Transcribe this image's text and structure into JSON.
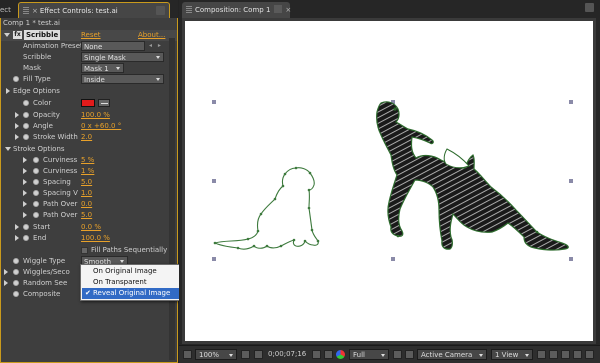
{
  "left_panel": {
    "cut_tab_label": "ect",
    "active_tab_label": "Effect Controls: test.ai",
    "comp_line": "Comp 1 * test.ai"
  },
  "effect": {
    "badge": "fx",
    "name": "Scribble",
    "reset_label": "Reset",
    "about_label": "About..."
  },
  "props": {
    "animation_preset": {
      "label": "Animation Preset",
      "value": "None"
    },
    "scribble": {
      "label": "Scribble",
      "value": "Single Mask"
    },
    "mask": {
      "label": "Mask",
      "value": "Mask 1"
    },
    "fill_type": {
      "label": "Fill Type",
      "value": "Inside"
    },
    "edge_options": {
      "label": "Edge Options"
    },
    "color": {
      "label": "Color",
      "value_color": "#e11b1b"
    },
    "opacity": {
      "label": "Opacity",
      "value": "100.0 %"
    },
    "angle": {
      "label": "Angle",
      "value": "0 x +60.0 °"
    },
    "stroke_width": {
      "label": "Stroke Width",
      "value": "2.0"
    },
    "stroke_options": {
      "label": "Stroke Options"
    },
    "curviness": {
      "label": "Curviness",
      "value": "5 %"
    },
    "curviness_var": {
      "label": "Curviness",
      "value": "1 %"
    },
    "spacing": {
      "label": "Spacing",
      "value": "5.0"
    },
    "spacing_var": {
      "label": "Spacing V",
      "value": "1.0"
    },
    "path_over1": {
      "label": "Path Over",
      "value": "0.0"
    },
    "path_over2": {
      "label": "Path Over",
      "value": "5.0"
    },
    "start": {
      "label": "Start",
      "value": "0.0 %"
    },
    "end": {
      "label": "End",
      "value": "100.0 %"
    },
    "fill_paths": {
      "label": "Fill Paths Sequentially"
    },
    "wiggle_type": {
      "label": "Wiggle Type",
      "value": "Smooth"
    },
    "wiggles_sec": {
      "label": "Wiggles/Seco"
    },
    "random_seed": {
      "label": "Random See"
    },
    "composite": {
      "label": "Composite"
    }
  },
  "popup": {
    "items": [
      "On Original Image",
      "On Transparent",
      "Reveal Original Image"
    ],
    "selected_index": 2,
    "check_glyph": "✔"
  },
  "comp_panel": {
    "tab_label": "Composition: Comp 1"
  },
  "toolbar": {
    "zoom": "100%",
    "timecode": "0;00;07;16",
    "resolution": "Full",
    "camera": "Active Camera",
    "views": "1 View"
  }
}
